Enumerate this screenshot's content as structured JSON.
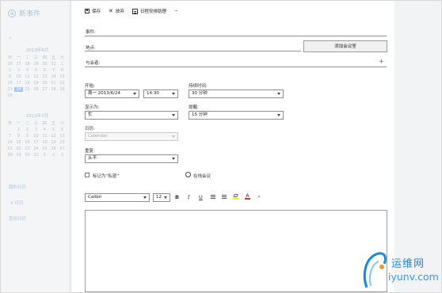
{
  "sidebar": {
    "new_event_label": "新事件",
    "month1_title": "2013年6月",
    "month2_title": "2013年7月",
    "weekdays": [
      "日",
      "一",
      "二",
      "三",
      "四",
      "五",
      "六"
    ],
    "month1_days": [
      "26",
      "27",
      "28",
      "29",
      "30",
      "31",
      "1",
      "2",
      "3",
      "4",
      "5",
      "6",
      "7",
      "8",
      "9",
      "10",
      "11",
      "12",
      "13",
      "14",
      "15",
      "16",
      "17",
      "18",
      "19",
      "20",
      "21",
      "22",
      "23",
      "24",
      "25",
      "26",
      "27",
      "28",
      "29",
      "30"
    ],
    "month1_selected": "24",
    "month2_days": [
      "",
      "1",
      "2",
      "3",
      "4",
      "5",
      "6",
      "7",
      "8",
      "9",
      "10",
      "11",
      "12",
      "13",
      "14",
      "15",
      "16",
      "17",
      "18",
      "19",
      "20",
      "21",
      "22",
      "23",
      "24",
      "25",
      "26",
      "27",
      "28",
      "29",
      "30",
      "31",
      "1",
      "2",
      "3"
    ],
    "my_calendars_label": "我的日历",
    "calendar_item_label": "X 日历",
    "other_calendars_label": "其他日历"
  },
  "toolbar": {
    "save_label": "保存",
    "discard_label": "放弃",
    "scheduling_label": "日程安排助理",
    "more_label": "···"
  },
  "form": {
    "event_label": "事件:",
    "location_label": "地点:",
    "add_room_label": "添加会议室",
    "attendees_label": "与会者:",
    "attendees_add": "+",
    "start_label": "开始:",
    "start_date": "周一 2013/6/24",
    "start_time": "14:30",
    "duration_label": "持续时间:",
    "duration_value": "30 分钟",
    "show_as_label": "显示为:",
    "show_as_value": "忙",
    "reminder_label": "提醒:",
    "reminder_value": "15 分钟",
    "calendar_label": "日历:",
    "calendar_value": "Calendar",
    "repeat_label": "重复:",
    "repeat_value": "从不",
    "private_label": "标记为“私密”",
    "online_meeting_label": "在线会议"
  },
  "format": {
    "font_name": "Calibri",
    "font_size": "12",
    "bold": "B",
    "italic": "I",
    "underline": "U",
    "font_color_glyph": "A",
    "more": "»"
  },
  "colors": {
    "highlight": "#ffe033",
    "font_color": "#e52b2b",
    "sidebar_accent": "#a9c6e6",
    "watermark": "#1a88d8"
  },
  "watermark": {
    "cn_text": "运维网",
    "en_text": "iyunv.com"
  }
}
